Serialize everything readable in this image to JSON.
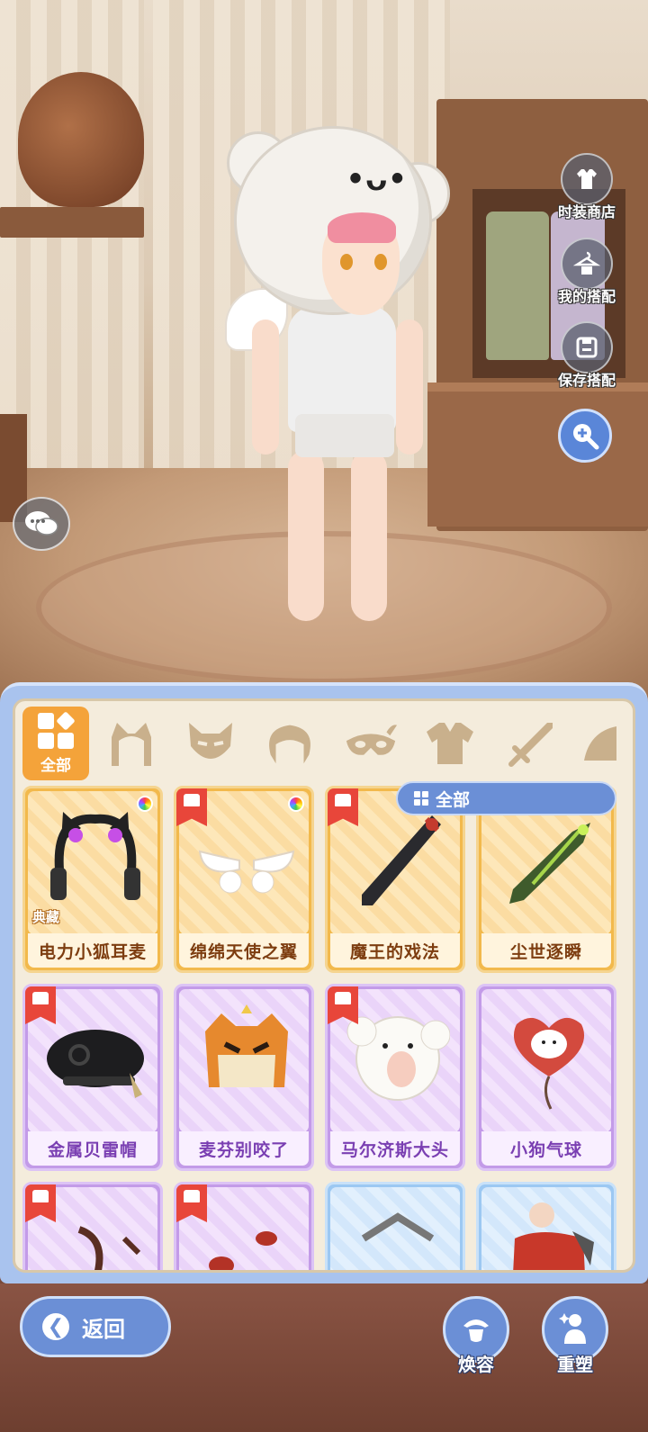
{
  "side_menu": [
    {
      "label": "时装商店",
      "icon": "fashion-shop-icon"
    },
    {
      "label": "我的搭配",
      "icon": "my-outfit-icon"
    },
    {
      "label": "保存搭配",
      "icon": "save-outfit-icon"
    }
  ],
  "zoom_icon": "zoom-in-icon",
  "chat_icon": "chat-bubble-icon",
  "tabs": {
    "active_label": "全部",
    "categories": [
      "cat-ears-icon",
      "fox-mask-icon",
      "hair-icon",
      "eye-mask-icon",
      "outfit-icon",
      "sword-icon",
      "wing-icon"
    ]
  },
  "filter": {
    "label": "全部"
  },
  "items": [
    {
      "name": "电力小狐耳麦",
      "rarity": "gold",
      "tag": "典藏",
      "dyeable": true,
      "owned": false
    },
    {
      "name": "绵绵天使之翼",
      "rarity": "gold",
      "dyeable": true,
      "owned": true
    },
    {
      "name": "魔王的戏法",
      "rarity": "gold",
      "owned": true
    },
    {
      "name": "尘世逐瞬",
      "rarity": "gold",
      "owned": false
    },
    {
      "name": "金属贝雷帽",
      "rarity": "purple",
      "owned": true
    },
    {
      "name": "麦芬别咬了",
      "rarity": "purple",
      "owned": false
    },
    {
      "name": "马尔济斯大头",
      "rarity": "purple",
      "owned": true
    },
    {
      "name": "小狗气球",
      "rarity": "purple",
      "owned": false
    },
    {
      "name": "",
      "rarity": "purple",
      "owned": true
    },
    {
      "name": "",
      "rarity": "purple",
      "owned": true
    },
    {
      "name": "",
      "rarity": "blue",
      "owned": false
    },
    {
      "name": "",
      "rarity": "blue",
      "owned": false
    }
  ],
  "bottom": {
    "back_label": "返回",
    "makeover_label": "焕容",
    "reshape_label": "重塑"
  },
  "colors": {
    "accent_blue": "#6b8fd6",
    "gold": "#f2b94c",
    "purple": "#c39be8",
    "tab_active": "#f4a33a"
  }
}
